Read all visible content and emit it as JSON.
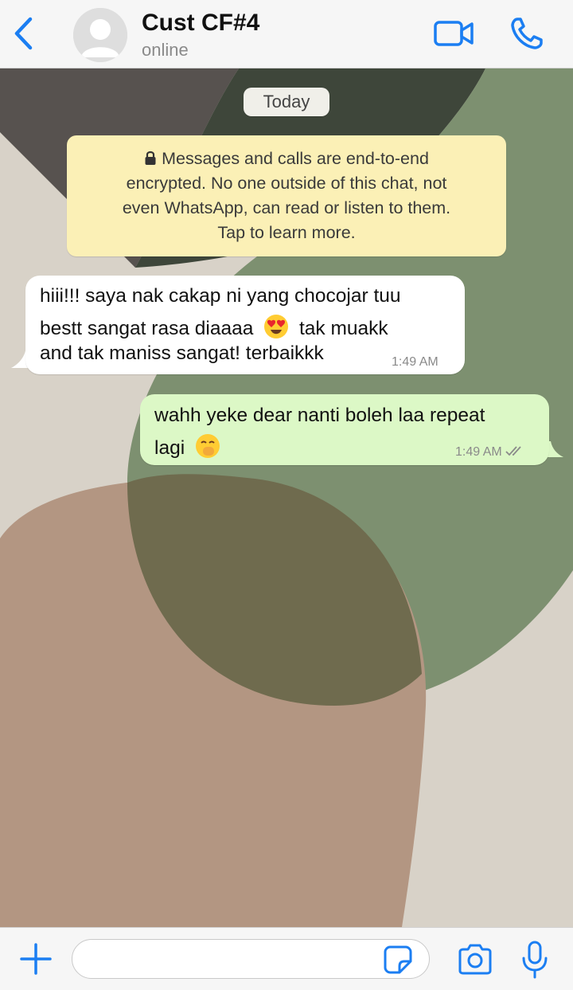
{
  "header": {
    "contact_name": "Cust CF#4",
    "status": "online"
  },
  "icons": {
    "back": "chevron-left-icon",
    "avatar": "default-avatar-icon",
    "video": "video-camera-icon",
    "call": "phone-icon",
    "lock": "lock-icon",
    "read": "double-check-icon",
    "plus": "plus-icon",
    "sticker": "sticker-icon",
    "camera": "camera-icon",
    "mic": "microphone-icon"
  },
  "colors": {
    "accent": "#1b7ef2",
    "incoming_bubble": "#ffffff",
    "outgoing_bubble": "#dcf8c6",
    "notice_bg": "#fbf0b6"
  },
  "chat": {
    "date_label": "Today",
    "encryption_notice": {
      "lines": [
        "Messages and calls are end-to-end",
        "encrypted. No one outside of this chat, not",
        "even WhatsApp, can read or listen to them.",
        "Tap to learn more."
      ]
    },
    "messages": [
      {
        "direction": "incoming",
        "lines": [
          "hiii!!! saya nak cakap ni yang chocojar tuu",
          "bestt sangat rasa diaaaa",
          "tak muakk",
          "and tak maniss sangat! terbaikkk"
        ],
        "emoji": "heart-eyes-emoji",
        "time": "1:49 AM"
      },
      {
        "direction": "outgoing",
        "lines": [
          "wahh yeke dear nanti boleh laa repeat",
          "lagi"
        ],
        "emoji": "hand-over-mouth-emoji",
        "time": "1:49 AM",
        "read": true
      }
    ]
  },
  "input": {
    "value": "",
    "placeholder": ""
  }
}
